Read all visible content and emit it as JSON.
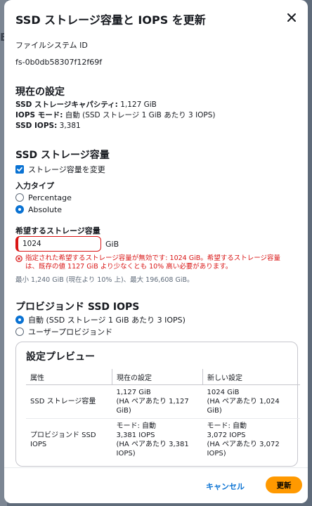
{
  "modal": {
    "title": "SSD ストレージ容量と IOPS を更新",
    "backdrop_letter": "B"
  },
  "filesystem": {
    "label": "ファイルシステム ID",
    "value": "fs-0b0db58307f12f69f"
  },
  "current": {
    "title": "現在の設定",
    "capacity_label": "SSD ストレージキャパシティ:",
    "capacity_value": " 1,127 GiB",
    "iops_mode_label": "IOPS モード:",
    "iops_mode_value": " 自動 (SSD ストレージ 1 GiB あたり 3 IOPS)",
    "iops_label": "SSD IOPS:",
    "iops_value": " 3,381"
  },
  "storage": {
    "title": "SSD ストレージ容量",
    "change_checkbox_label": "ストレージ容量を変更",
    "change_checked": true,
    "input_type_label": "入力タイプ",
    "options": [
      "Percentage",
      "Absolute"
    ],
    "selected_option": "Absolute",
    "desired_label": "希望するストレージ容量",
    "desired_value": "1024",
    "unit": "GiB",
    "error_text": "指定された希望するストレージ容量が無効です: 1024 GiB。希望するストレージ容量は、既存の値 1127 GiB より少なくとも 10% 高い必要があります。",
    "hint": "最小 1,240 GiB (現在より 10% 上)、最大 196,608 GiB。"
  },
  "iops": {
    "title": "プロビジョンド SSD IOPS",
    "options": [
      "自動 (SSD ストレージ 1 GiB あたり 3 IOPS)",
      "ユーザープロビジョンド"
    ],
    "selected_option": "自動 (SSD ストレージ 1 GiB あたり 3 IOPS)"
  },
  "preview": {
    "title": "設定プレビュー",
    "headers": [
      "属性",
      "現在の設定",
      "新しい設定"
    ],
    "rows": [
      {
        "attribute": "SSD ストレージ容量",
        "current": [
          "1,127 GiB",
          "(HA ペアあたり 1,127",
          "GiB)"
        ],
        "new": [
          "1024 GiB",
          "(HA ペアあたり 1,024",
          "GiB)"
        ]
      },
      {
        "attribute": [
          "プロビジョンド SSD",
          "IOPS"
        ],
        "current": [
          "モード: 自動",
          "3,381 IOPS",
          "(HA ペアあたり 3,381",
          "IOPS)"
        ],
        "new": [
          "モード: 自動",
          "3,072 IOPS",
          "(HA ペアあたり 3,072",
          "IOPS)"
        ]
      }
    ]
  },
  "footer": {
    "cancel_label": "キャンセル",
    "update_label": "更新"
  },
  "colors": {
    "primary": "#ff9900",
    "link": "#0972d3",
    "error": "#d91515"
  }
}
